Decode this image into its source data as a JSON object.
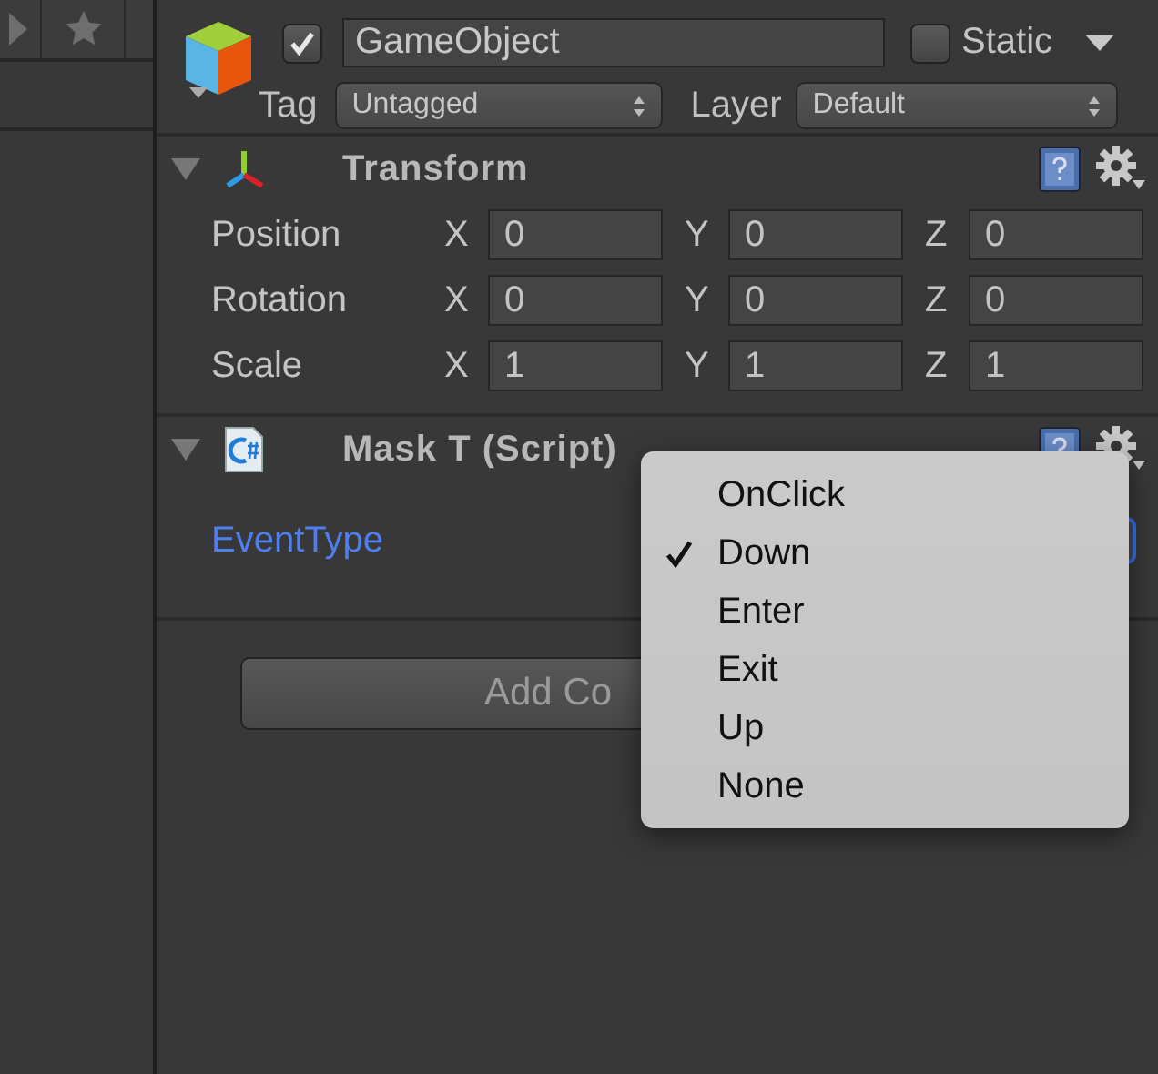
{
  "game_object": {
    "active": true,
    "name": "GameObject",
    "static": false,
    "static_label": "Static",
    "tag_label": "Tag",
    "tag": "Untagged",
    "layer_label": "Layer",
    "layer": "Default"
  },
  "components": [
    {
      "kind": "transform",
      "title": "Transform",
      "expanded": true,
      "rows": [
        {
          "label": "Position",
          "fields": [
            {
              "axis": "X",
              "value": "0"
            },
            {
              "axis": "Y",
              "value": "0"
            },
            {
              "axis": "Z",
              "value": "0"
            }
          ]
        },
        {
          "label": "Rotation",
          "fields": [
            {
              "axis": "X",
              "value": "0"
            },
            {
              "axis": "Y",
              "value": "0"
            },
            {
              "axis": "Z",
              "value": "0"
            }
          ]
        },
        {
          "label": "Scale",
          "fields": [
            {
              "axis": "X",
              "value": "1"
            },
            {
              "axis": "Y",
              "value": "1"
            },
            {
              "axis": "Z",
              "value": "1"
            }
          ]
        }
      ]
    },
    {
      "kind": "script",
      "title": "Mask T (Script)",
      "expanded": true,
      "properties": [
        {
          "label": "EventType",
          "focused": true
        }
      ]
    }
  ],
  "add_component_button": "Add Co",
  "dropdown_menu": {
    "items": [
      {
        "label": "OnClick",
        "selected": false
      },
      {
        "label": "Down",
        "selected": true
      },
      {
        "label": "Enter",
        "selected": false
      },
      {
        "label": "Exit",
        "selected": false
      },
      {
        "label": "Up",
        "selected": false
      },
      {
        "label": "None",
        "selected": false
      }
    ]
  }
}
